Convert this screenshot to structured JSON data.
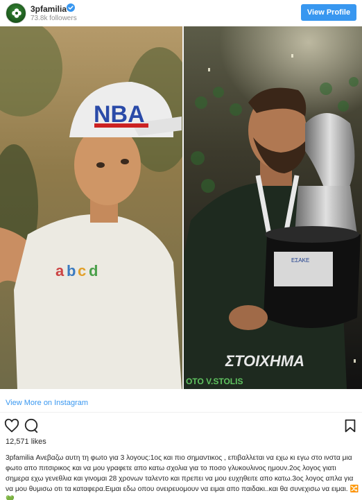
{
  "header": {
    "username": "3pfamilia",
    "followers": "73.8k followers",
    "view_profile_label": "View Profile"
  },
  "photo": {
    "left_cap_text": "NBA",
    "right_watermark": "OTO V.STOLIS",
    "jersey_text": "ΣΤΟΙΧΗΜΑ",
    "trophy_label": "ΕΣΑΚΕ"
  },
  "view_more": "View More on Instagram",
  "likes": "12,571 likes",
  "caption": {
    "user": "3pfamilia",
    "text": "Ανεβαζω αυτη τη φωτο για 3 λογους:1ος και πιο σημαντικος , επιβαλλεται να εχω κι εγω στο ινστα μια φωτο απο πιτσιρικος και να μου γραφετε απο κατω σχολια για το ποσο γλυκουλινος ημουν.2ος λογος γιατι σημερα εχω γενεθλια και γινομαι 28 χρονων ταλεντο και πρεπει να μου ευχηθειτε απο κατω.3ος λογος απλα για να μου θυμισω οτι τα καταφερα.Ειμαι εδω οπου ονειρευομουν να ειμαι απο παιδακι..και θα συνεχισω να ειμαι.",
    "emoji": "🔀💚"
  },
  "colors": {
    "accent": "#3897f0",
    "verified": "#3897f0",
    "brand_green": "#2e7d32"
  }
}
